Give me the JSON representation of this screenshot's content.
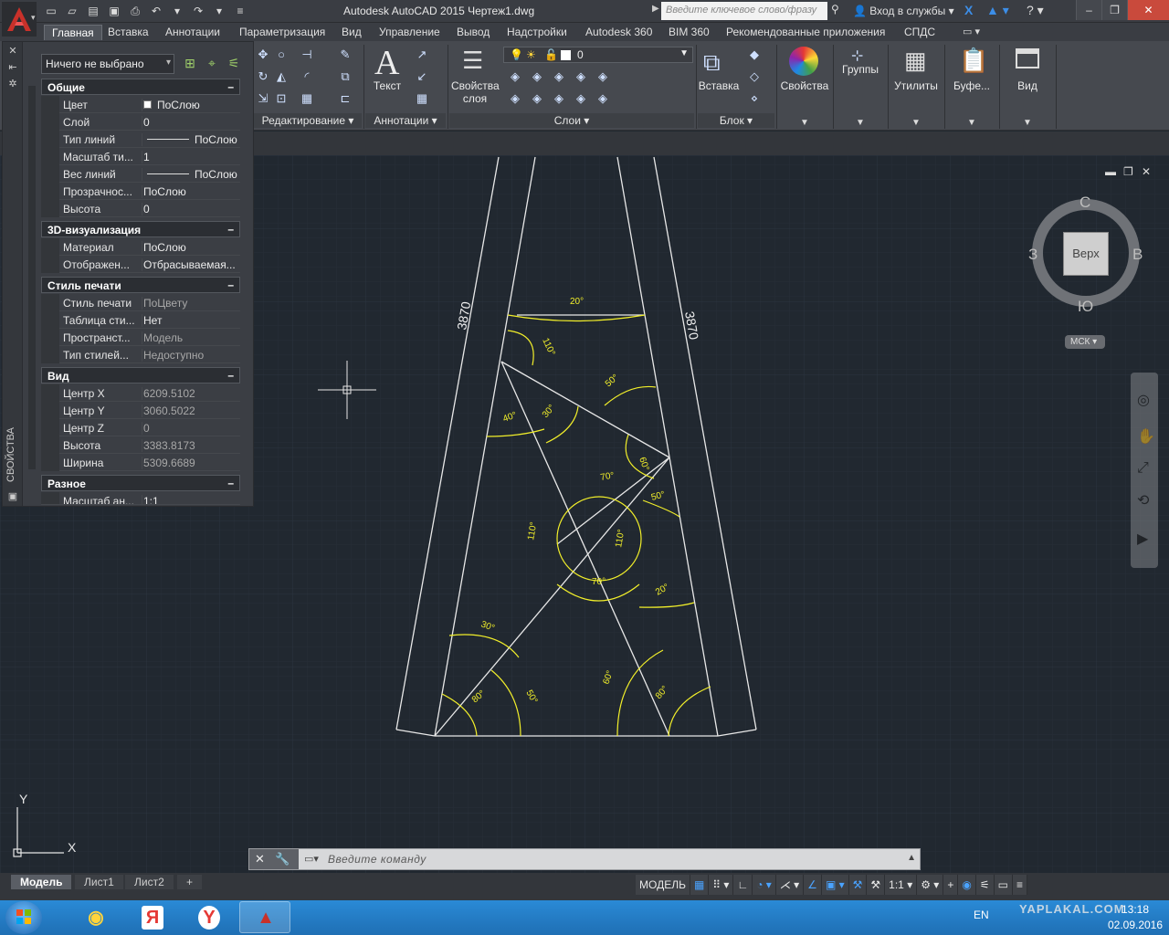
{
  "title_bar": {
    "title": "Autodesk AutoCAD 2015    Чертеж1.dwg",
    "search_placeholder": "Введите ключевое слово/фразу",
    "login": "Вход в службы"
  },
  "ribbon_tabs": [
    "Главная",
    "Вставка",
    "Аннотации",
    "Параметризация",
    "Вид",
    "Управление",
    "Вывод",
    "Надстройки",
    "Autodesk 360",
    "BIM 360",
    "Рекомендованные приложения",
    "СПДС"
  ],
  "ribbon": {
    "text_label": "Текст",
    "layer_props_label": "Свойства слоя",
    "layer_value": "0",
    "insert_label": "Вставка",
    "properties_label": "Свойства",
    "groups_label": "Группы",
    "utilities_label": "Утилиты",
    "clipboard_label": "Буфе...",
    "view_label": "Вид",
    "panel_edit": "Редактирование",
    "panel_annot": "Аннотации",
    "panel_layers": "Слои",
    "panel_block": "Блок"
  },
  "properties": {
    "selection": "Ничего не выбрано",
    "palette_title": "СВОЙСТВА",
    "sections": {
      "general": "Общие",
      "viz3d": "3D-визуализация",
      "plotstyle": "Стиль печати",
      "view": "Вид",
      "misc": "Разное"
    },
    "general_rows": [
      {
        "k": "Цвет",
        "v": "ПоСлою"
      },
      {
        "k": "Слой",
        "v": "0"
      },
      {
        "k": "Тип линий",
        "v": "ПоСлою"
      },
      {
        "k": "Масштаб ти...",
        "v": "1"
      },
      {
        "k": "Вес линий",
        "v": "ПоСлою"
      },
      {
        "k": "Прозрачнос...",
        "v": "ПоСлою"
      },
      {
        "k": "Высота",
        "v": "0"
      }
    ],
    "viz_rows": [
      {
        "k": "Материал",
        "v": "ПоСлою"
      },
      {
        "k": "Отображен...",
        "v": "Отбрасываемая..."
      }
    ],
    "plot_rows": [
      {
        "k": "Стиль печати",
        "v": "ПоЦвету"
      },
      {
        "k": "Таблица сти...",
        "v": "Нет"
      },
      {
        "k": "Пространст...",
        "v": "Модель"
      },
      {
        "k": "Тип стилей...",
        "v": "Недоступно"
      }
    ],
    "view_rows": [
      {
        "k": "Центр X",
        "v": "6209.5102"
      },
      {
        "k": "Центр Y",
        "v": "3060.5022"
      },
      {
        "k": "Центр Z",
        "v": "0"
      },
      {
        "k": "Высота",
        "v": "3383.8173"
      },
      {
        "k": "Ширина",
        "v": "5309.6689"
      }
    ],
    "misc_rows": [
      {
        "k": "Масштаб ан...",
        "v": "1:1"
      }
    ]
  },
  "viewcube": {
    "face": "Верх",
    "north": "С",
    "south": "Ю",
    "west": "З",
    "east": "В",
    "ucs": "МСК"
  },
  "drawing": {
    "dim_left": "3870",
    "dim_right": "3870",
    "angles": [
      "20°",
      "110°",
      "50°",
      "40°",
      "30°",
      "60°",
      "70°",
      "50°",
      "110°",
      "110°",
      "70°",
      "20°",
      "30°",
      "50°",
      "80°",
      "60°",
      "80°"
    ],
    "ucs_x": "X",
    "ucs_y": "Y"
  },
  "command_line": {
    "placeholder": "Введите команду"
  },
  "layout_tabs": [
    "Модель",
    "Лист1",
    "Лист2"
  ],
  "status": {
    "model": "МОДЕЛЬ",
    "scale": "1:1"
  },
  "taskbar": {
    "lang": "EN",
    "time": "13:18",
    "date": "02.09.2016",
    "watermark": "YAPLAKAL.COM"
  },
  "colors": {
    "accent_red": "#c8312a",
    "drawing_bg": "#212830",
    "angle_yellow": "#f2ef2a",
    "taskbar_blue": "#1f6fb4"
  }
}
